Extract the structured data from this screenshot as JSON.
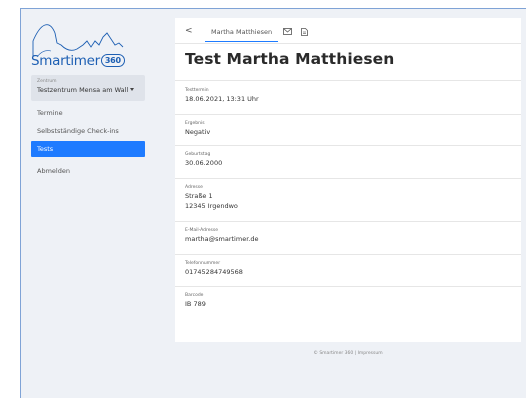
{
  "sidebar": {
    "logo_text": "Smartimer",
    "logo_badge": "360",
    "center_label": "Zentrum",
    "center_value": "Testzentrum Mensa am Wall",
    "nav": {
      "termine": "Termine",
      "checkins": "Selbstständige Check-ins",
      "tests": "Tests",
      "logout": "Abmelden"
    }
  },
  "tabs": {
    "back": "<",
    "name": "Martha Matthiesen"
  },
  "page_title": "Test Martha Matthiesen",
  "fields": {
    "testtermin": {
      "label": "Testtermin",
      "value": "18.06.2021, 13:31 Uhr"
    },
    "ergebnis": {
      "label": "Ergebnis",
      "value": "Negativ"
    },
    "geburtstag": {
      "label": "Geburtstag",
      "value": "30.06.2000"
    },
    "adresse": {
      "label": "Adresse",
      "line1": "Straße 1",
      "line2": "12345 Irgendwo"
    },
    "email": {
      "label": "E-Mail-Adresse",
      "value": "martha@smartimer.de"
    },
    "telefon": {
      "label": "Telefonnummer",
      "value": "01745284749568"
    },
    "barcode": {
      "label": "Barcode",
      "value": "IB 789"
    }
  },
  "footer": "© Smartimer 360 | Impressum",
  "colors": {
    "accent": "#1e7bff",
    "brand": "#1d5fb3",
    "background": "#eef1f6"
  }
}
